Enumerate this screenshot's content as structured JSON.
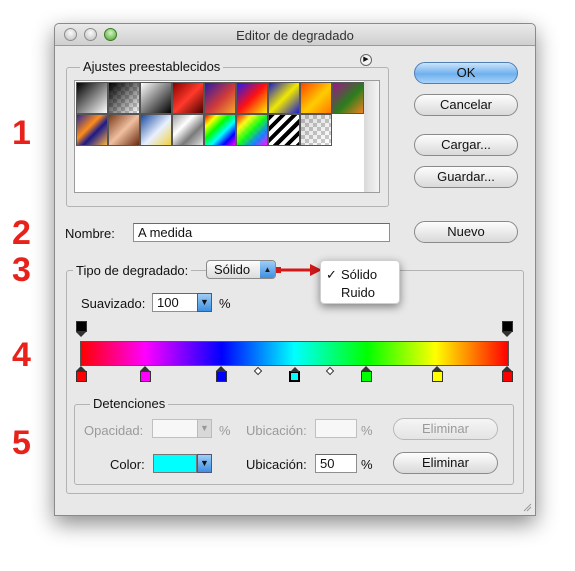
{
  "window": {
    "title": "Editor de degradado"
  },
  "presets": {
    "group_label": "Ajustes preestablecidos"
  },
  "buttons": {
    "ok": "OK",
    "cancel": "Cancelar",
    "load": "Cargar...",
    "save": "Guardar...",
    "new": "Nuevo"
  },
  "name_row": {
    "label": "Nombre:",
    "value": "A medida"
  },
  "gradient_type": {
    "label": "Tipo de degradado:",
    "selected": "Sólido",
    "menu_options": [
      "Sólido",
      "Ruido"
    ],
    "checkmark": "✓"
  },
  "smoothness": {
    "label": "Suavizado:",
    "value": "100",
    "unit": "%"
  },
  "stops_group": {
    "label": "Detenciones",
    "opacity_label": "Opacidad:",
    "opacity_unit": "%",
    "location_label": "Ubicación:",
    "location_unit": "%",
    "color_label": "Color:",
    "color_location_value": "50",
    "color_value": "#00ffff",
    "delete_label": "Eliminar"
  },
  "annotations": [
    "1",
    "2",
    "3",
    "4",
    "5"
  ],
  "gradient_bar": {
    "colors": [
      "#ff0000",
      "#ff00ff",
      "#0000ff",
      "#00ffff",
      "#00ff00",
      "#ffff00",
      "#ff0000"
    ],
    "color_stops_percent": [
      0,
      15,
      33,
      50,
      67,
      83,
      100
    ]
  }
}
